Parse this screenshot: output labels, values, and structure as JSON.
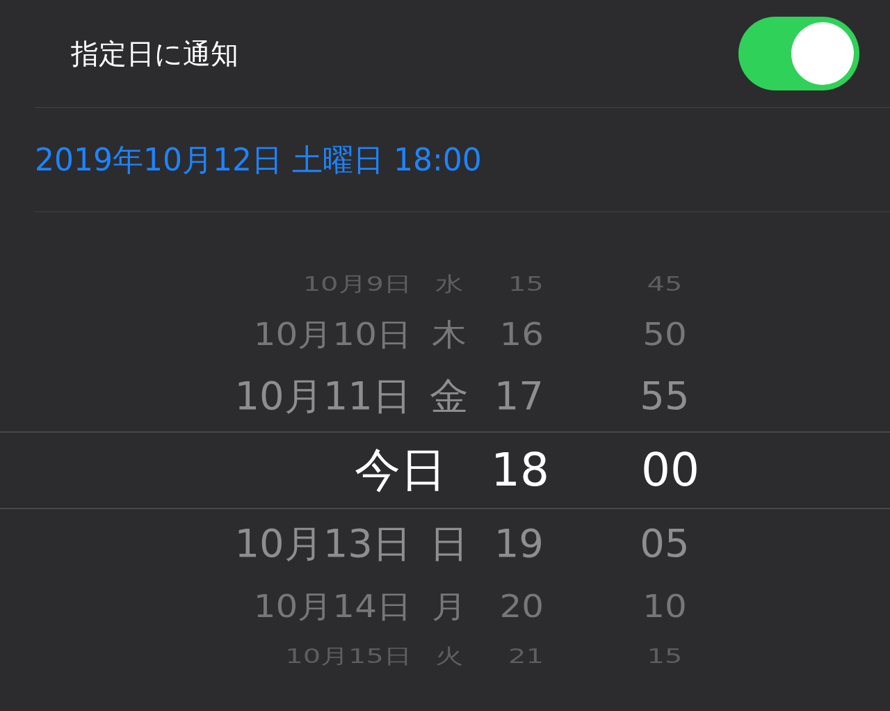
{
  "notify": {
    "label": "指定日に通知",
    "on": true
  },
  "date_value": "2019年10月12日 土曜日 18:00",
  "picker": {
    "rows": [
      {
        "kind": "date",
        "date": "10月9日",
        "weekday": "水",
        "hour": "15",
        "minute": "45",
        "selected": false
      },
      {
        "kind": "date",
        "date": "10月10日",
        "weekday": "木",
        "hour": "16",
        "minute": "50",
        "selected": false
      },
      {
        "kind": "date",
        "date": "10月11日",
        "weekday": "金",
        "hour": "17",
        "minute": "55",
        "selected": false
      },
      {
        "kind": "today",
        "date": "今日",
        "hour": "18",
        "minute": "00",
        "selected": true
      },
      {
        "kind": "date",
        "date": "10月13日",
        "weekday": "日",
        "hour": "19",
        "minute": "05",
        "selected": false
      },
      {
        "kind": "date",
        "date": "10月14日",
        "weekday": "月",
        "hour": "20",
        "minute": "10",
        "selected": false
      },
      {
        "kind": "date",
        "date": "10月15日",
        "weekday": "火",
        "hour": "21",
        "minute": "15",
        "selected": false
      }
    ]
  }
}
